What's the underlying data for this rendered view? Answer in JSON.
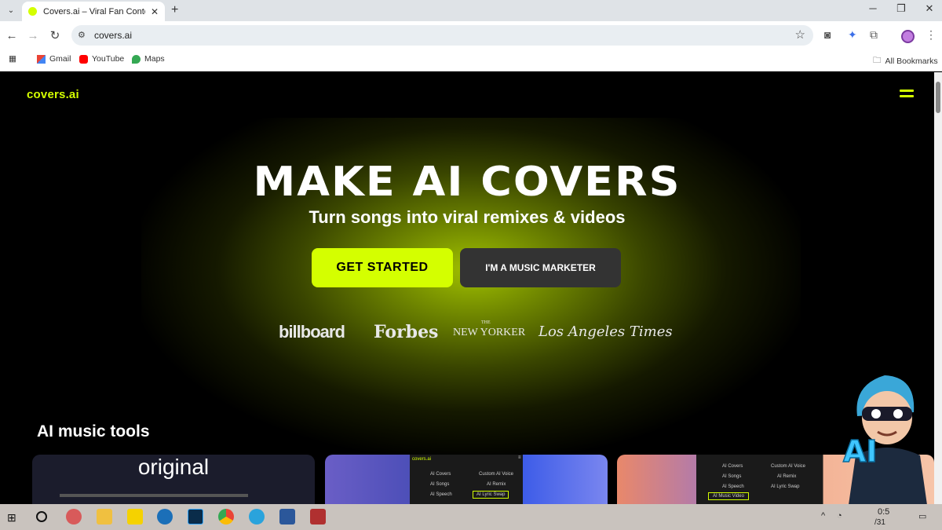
{
  "browser": {
    "tab_title": "Covers.ai – Viral Fan Content To",
    "url": "covers.ai",
    "bookmarks": [
      {
        "label": "Gmail"
      },
      {
        "label": "YouTube"
      },
      {
        "label": "Maps"
      }
    ],
    "all_bookmarks_label": "All Bookmarks"
  },
  "site": {
    "logo": "covers.ai",
    "hero_title": "MAKE AI COVERS",
    "hero_subtitle": "Turn songs into viral remixes & videos",
    "cta_primary": "GET STARTED",
    "cta_secondary": "I'M A MUSIC MARKETER",
    "press": [
      "billboard",
      "Forbes",
      "NEW YORKER",
      "Los Angeles Times"
    ],
    "press_nyer_small": "THE",
    "tools_title": "AI music tools",
    "card1_label": "original",
    "card2_ui": {
      "logo": "covers.ai",
      "items": [
        "AI Covers",
        "Custom AI Voice",
        "AI Songs",
        "AI Remix",
        "AI Speech",
        "AI Lyric Swap"
      ]
    },
    "card3_ui": {
      "items": [
        "AI Covers",
        "Custom AI Voice",
        "AI Songs",
        "AI Remix",
        "AI Speech",
        "AI Lyric Swap",
        "AI Music Video"
      ]
    },
    "mascot_text": "AI"
  },
  "colors": {
    "accent": "#d4ff00",
    "background": "#000000",
    "secondary_button": "#333333"
  },
  "taskbar": {
    "time": "0:5",
    "date": "/31"
  }
}
